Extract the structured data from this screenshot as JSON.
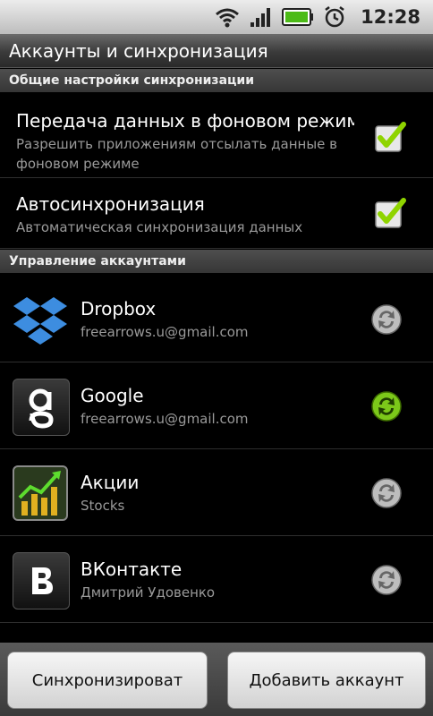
{
  "status_bar": {
    "time": "12:28"
  },
  "title": "Аккаунты и синхронизация",
  "general_section": {
    "header": "Общие настройки синхронизации",
    "settings": [
      {
        "title": "Передача данных в фоновом режиме",
        "summary": "Разрешить приложениям отсылать данные в фоновом режиме",
        "checked": true
      },
      {
        "title": "Автосинхронизация",
        "summary": "Автоматическая синхронизация данных",
        "checked": true
      }
    ]
  },
  "accounts_section": {
    "header": "Управление аккаунтами",
    "accounts": [
      {
        "name": "Dropbox",
        "sub": "freearrows.u@gmail.com",
        "icon": "dropbox-icon",
        "sync_active": false
      },
      {
        "name": "Google",
        "sub": "freearrows.u@gmail.com",
        "icon": "google-icon",
        "sync_active": true
      },
      {
        "name": "Акции",
        "sub": "Stocks",
        "icon": "stocks-icon",
        "sync_active": false
      },
      {
        "name": "ВКонтакте",
        "sub": "Дмитрий Удовенко",
        "icon": "vkontakte-icon",
        "sync_active": false
      }
    ]
  },
  "buttons": {
    "sync": "Синхронизироват",
    "add_account": "Добавить аккаунт"
  },
  "colors": {
    "check_green": "#8fd400",
    "sync_active": "#7cc81a",
    "sync_inactive": "#9a9a9a",
    "dropbox_blue": "#3d8de0"
  }
}
